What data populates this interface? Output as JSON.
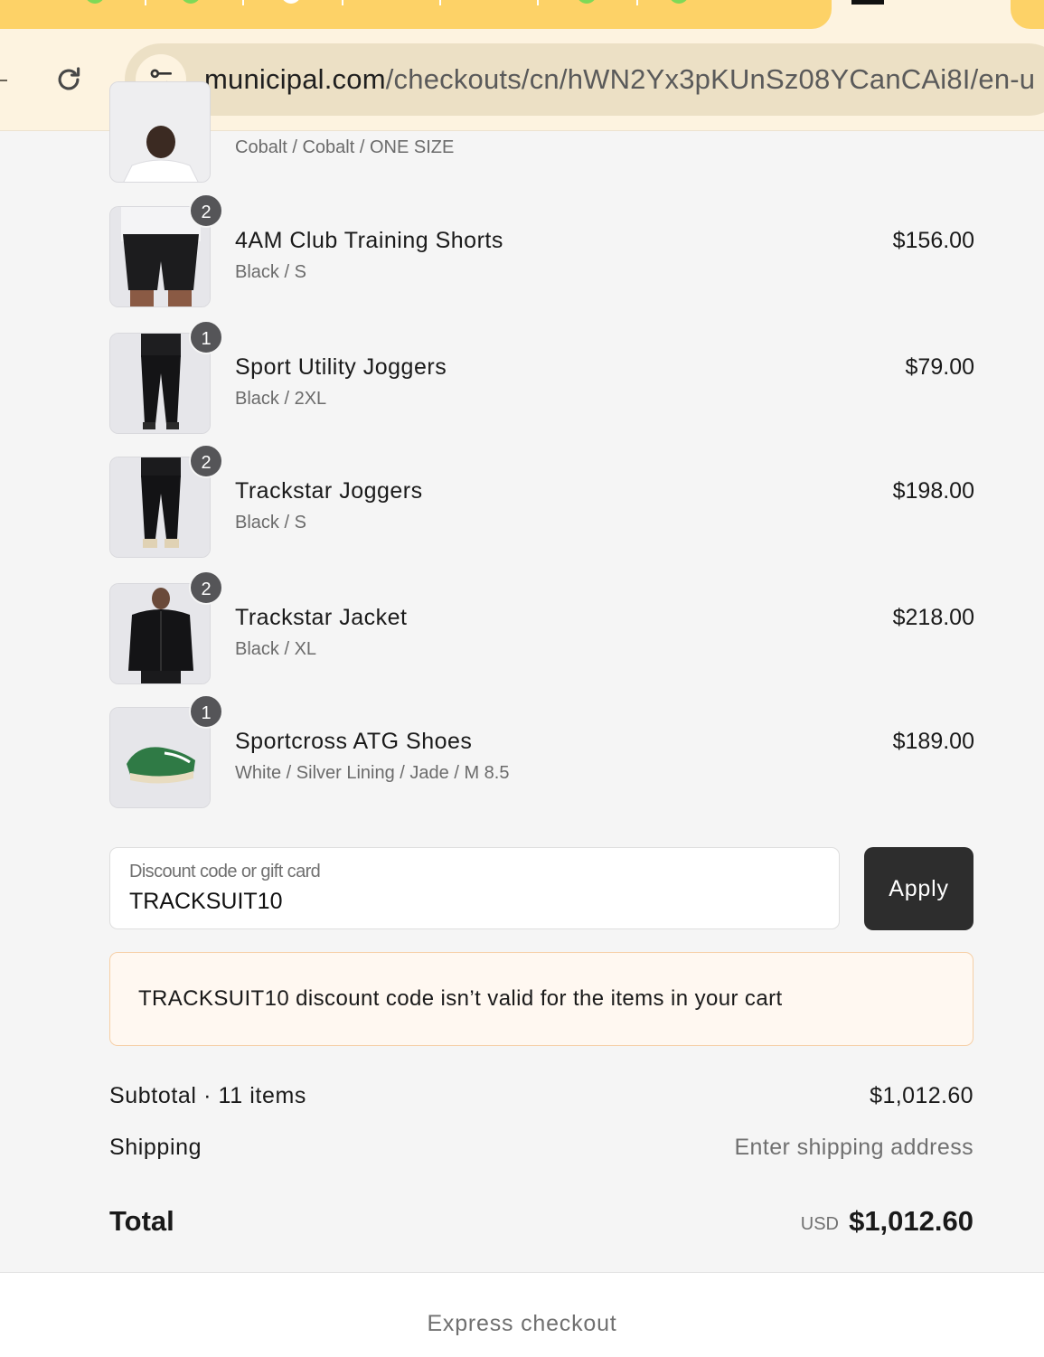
{
  "browser": {
    "url_host": "municipal.com",
    "url_path": "/checkouts/cn/hWN2Yx3pKUnSz08YCanCAi8I/en-u",
    "tab_accent_colors": [
      "#7ed957",
      "#ffffff",
      "#7ed957"
    ]
  },
  "cart": {
    "partial_item": {
      "variant": "Cobalt / Cobalt / ONE SIZE"
    },
    "items": [
      {
        "qty": "2",
        "name": "4AM Club Training Shorts",
        "variant": "Black / S",
        "price": "$156.00",
        "image": "shorts-photo"
      },
      {
        "qty": "1",
        "name": "Sport Utility Joggers",
        "variant": "Black / 2XL",
        "price": "$79.00",
        "image": "joggers-photo"
      },
      {
        "qty": "2",
        "name": "Trackstar Joggers",
        "variant": "Black / S",
        "price": "$198.00",
        "image": "joggers-photo"
      },
      {
        "qty": "2",
        "name": "Trackstar Jacket",
        "variant": "Black / XL",
        "price": "$218.00",
        "image": "jacket-photo"
      },
      {
        "qty": "1",
        "name": "Sportcross ATG Shoes",
        "variant": "White / Silver Lining / Jade / M 8.5",
        "price": "$189.00",
        "image": "shoe-photo"
      }
    ]
  },
  "discount": {
    "label": "Discount code or gift card",
    "value": "TRACKSUIT10",
    "apply_label": "Apply",
    "error": "TRACKSUIT10 discount code isn’t valid for the items in your cart"
  },
  "summary": {
    "subtotal_label": "Subtotal · 11 items",
    "subtotal_value": "$1,012.60",
    "shipping_label": "Shipping",
    "shipping_value": "Enter shipping address",
    "total_label": "Total",
    "total_currency": "USD",
    "total_value": "$1,012.60"
  },
  "footer": {
    "express_label": "Express checkout"
  },
  "colors": {
    "tab_yellow": "#fdd267",
    "toolbar_bg": "#fdf3e0",
    "button_dark": "#2d2d2d",
    "error_bg": "#fff8f1",
    "error_border": "#f6cfa6",
    "badge": "#555558"
  }
}
